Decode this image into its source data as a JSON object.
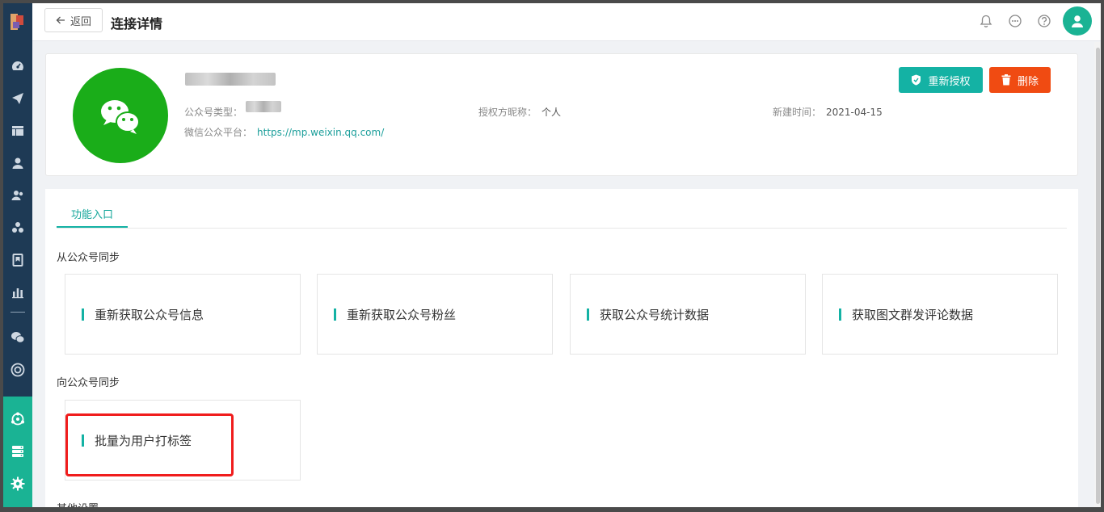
{
  "header": {
    "back_label": "返回",
    "title": "连接详情"
  },
  "account": {
    "type_label": "公众号类型：",
    "nickname_label": "授权方昵称：",
    "nickname_value": "个人",
    "created_label": "新建时间：",
    "created_value": "2021-04-15",
    "platform_label": "微信公众平台：",
    "platform_url": "https://mp.weixin.qq.com/"
  },
  "actions": {
    "reauth_label": "重新授权",
    "delete_label": "删除"
  },
  "tabs": [
    {
      "label": "功能入口"
    }
  ],
  "sections": [
    {
      "title": "从公众号同步",
      "items": [
        "重新获取公众号信息",
        "重新获取公众号粉丝",
        "获取公众号统计数据",
        "获取图文群发评论数据"
      ]
    },
    {
      "title": "向公众号同步",
      "items": [
        "批量为用户打标签"
      ]
    },
    {
      "title": "其他设置"
    }
  ],
  "colors": {
    "accent": "#14b2a4",
    "danger": "#f04b12",
    "sidebar": "#1e3a55",
    "wechat": "#1aad19",
    "highlight": "#f01c1c"
  }
}
